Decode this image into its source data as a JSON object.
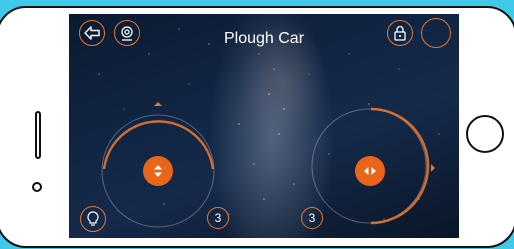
{
  "app": {
    "title": "Plough Car"
  },
  "toolbar": {
    "left_icons": [
      "back-arrow-icon",
      "webcam-icon"
    ],
    "right_icons": [
      "lock-icon",
      "blank-circle-icon"
    ]
  },
  "controls": {
    "left_joystick": {
      "direction": "vertical",
      "speed_label": "3"
    },
    "right_joystick": {
      "direction": "horizontal",
      "speed_label": "3"
    },
    "light_icon": "lightbulb-icon"
  },
  "colors": {
    "accent": "#e8762a",
    "knob": "#e8651a",
    "frame_background": "#3ec8ea"
  }
}
